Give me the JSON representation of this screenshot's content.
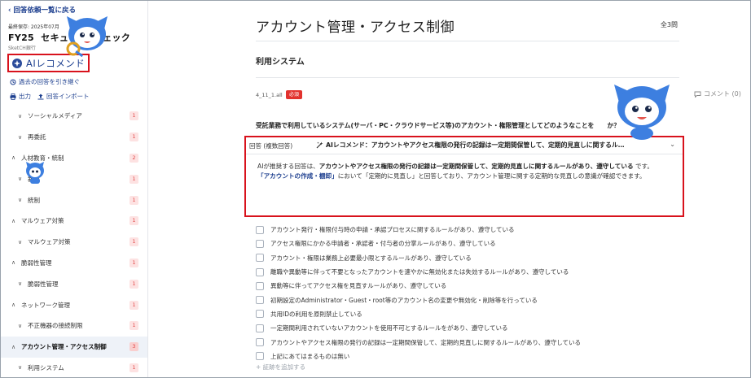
{
  "sidebar": {
    "back_link": "回答依頼一覧に戻る",
    "saved_label": "最終保存: 2025年07月",
    "sheet_title_prefix": "FY25",
    "sheet_title_suffix": "セキュ",
    "sheet_title_end": "ェック",
    "org_name": "SketCH銀行",
    "ai_recommend_label": "AIレコメンド",
    "carry_over_label": "過去の回答を引き継ぐ",
    "export_label": "出力",
    "import_label": "回答インポート",
    "nav": [
      {
        "label": "ソーシャルメディア",
        "level": 2,
        "count": "1",
        "chevron": "∨"
      },
      {
        "label": "再委託",
        "level": 2,
        "count": "1",
        "chevron": "∨"
      },
      {
        "label": "人材教育・統制",
        "level": 1,
        "count": "2",
        "chevron": "∧"
      },
      {
        "label": "教育",
        "level": 2,
        "count": "1",
        "chevron": "∨"
      },
      {
        "label": "統制",
        "level": 2,
        "count": "1",
        "chevron": "∨"
      },
      {
        "label": "マルウェア対策",
        "level": 1,
        "count": "1",
        "chevron": "∧"
      },
      {
        "label": "マルウェア対策",
        "level": 2,
        "count": "1",
        "chevron": "∨"
      },
      {
        "label": "脆弱性管理",
        "level": 1,
        "count": "1",
        "chevron": "∧"
      },
      {
        "label": "脆弱性管理",
        "level": 2,
        "count": "1",
        "chevron": "∨"
      },
      {
        "label": "ネットワーク管理",
        "level": 1,
        "count": "1",
        "chevron": "∧"
      },
      {
        "label": "不正機器の接続制限",
        "level": 2,
        "count": "1",
        "chevron": "∨"
      },
      {
        "label": "アカウント管理・アクセス制御",
        "level": 1,
        "count": "3",
        "chevron": "∧",
        "active": true
      },
      {
        "label": "利用システム",
        "level": 2,
        "count": "1",
        "chevron": "∨"
      }
    ]
  },
  "main": {
    "page_title": "アカウント管理・アクセス制御",
    "total_label": "全3問",
    "section_title": "利用システム",
    "question_id": "4_11_1.all",
    "required_label": "必須",
    "comment_label": "コメント (0)",
    "question_text": "受託業務で利用しているシステム(サーバ・PC・クラウドサービス等)のアカウント・権限管理としてどのようなことを",
    "question_tail": "か？",
    "answer_type": "回答 (複数回答)",
    "ai_summary": "AIレコメンド：アカウントやアクセス権限の発行の記録は一定期間保管して、定期的見直しに関するル…",
    "ai_body_1": "AIが推奨する回答は、",
    "ai_body_strong": "アカウントやアクセス権限の発行の記録は一定期間保管して、定期的見直しに関するルールがあり、遵守している",
    "ai_body_2": "です。",
    "ai_body_link": "「アカウントの作成・棚卸」",
    "ai_body_3": "において「定期的に見直し」と回答しており、アカウント管理に関する定期的な見直しの意識が確認できます。",
    "options": [
      "アカウント発行・権限付与時の申請・承認プロセスに関するルールがあり、遵守している",
      "アクセス権限にかかる申請者・承認者・付与者の分掌ルールがあり、遵守している",
      "アカウント・権限は業務上必要最小限とするルールがあり、遵守している",
      "離職や異動等に伴って不要となったアカウントを速やかに無効化または失効するルールがあり、遵守している",
      "異動等に伴ってアクセス権を見直すルールがあり、遵守している",
      "初期設定のAdministrator・Guest・root等のアカウント名の変更や無効化・削除等を行っている",
      "共用IDの利用を原則禁止している",
      "一定期間利用されていないアカウントを使用不可とするルールをがあり、遵守している",
      "アカウントやアクセス権限の発行の記録は一定期間保管して、定期的見直しに関するルールがあり、遵守している",
      "上記にあてはまるものは無い"
    ],
    "add_evidence_label": "+ 証跡を追加する"
  },
  "colors": {
    "accent_blue": "#1d3f8f",
    "highlight_red": "#d8121c",
    "badge_bg": "#fde2e2",
    "badge_text": "#e24b4b",
    "mascot_blue": "#3d7fe0"
  },
  "icons": [
    "chevron-left-icon",
    "ai-sparkle-icon",
    "history-icon",
    "print-icon",
    "upload-icon",
    "comment-icon",
    "chevron-down-icon",
    "mascot-character"
  ]
}
